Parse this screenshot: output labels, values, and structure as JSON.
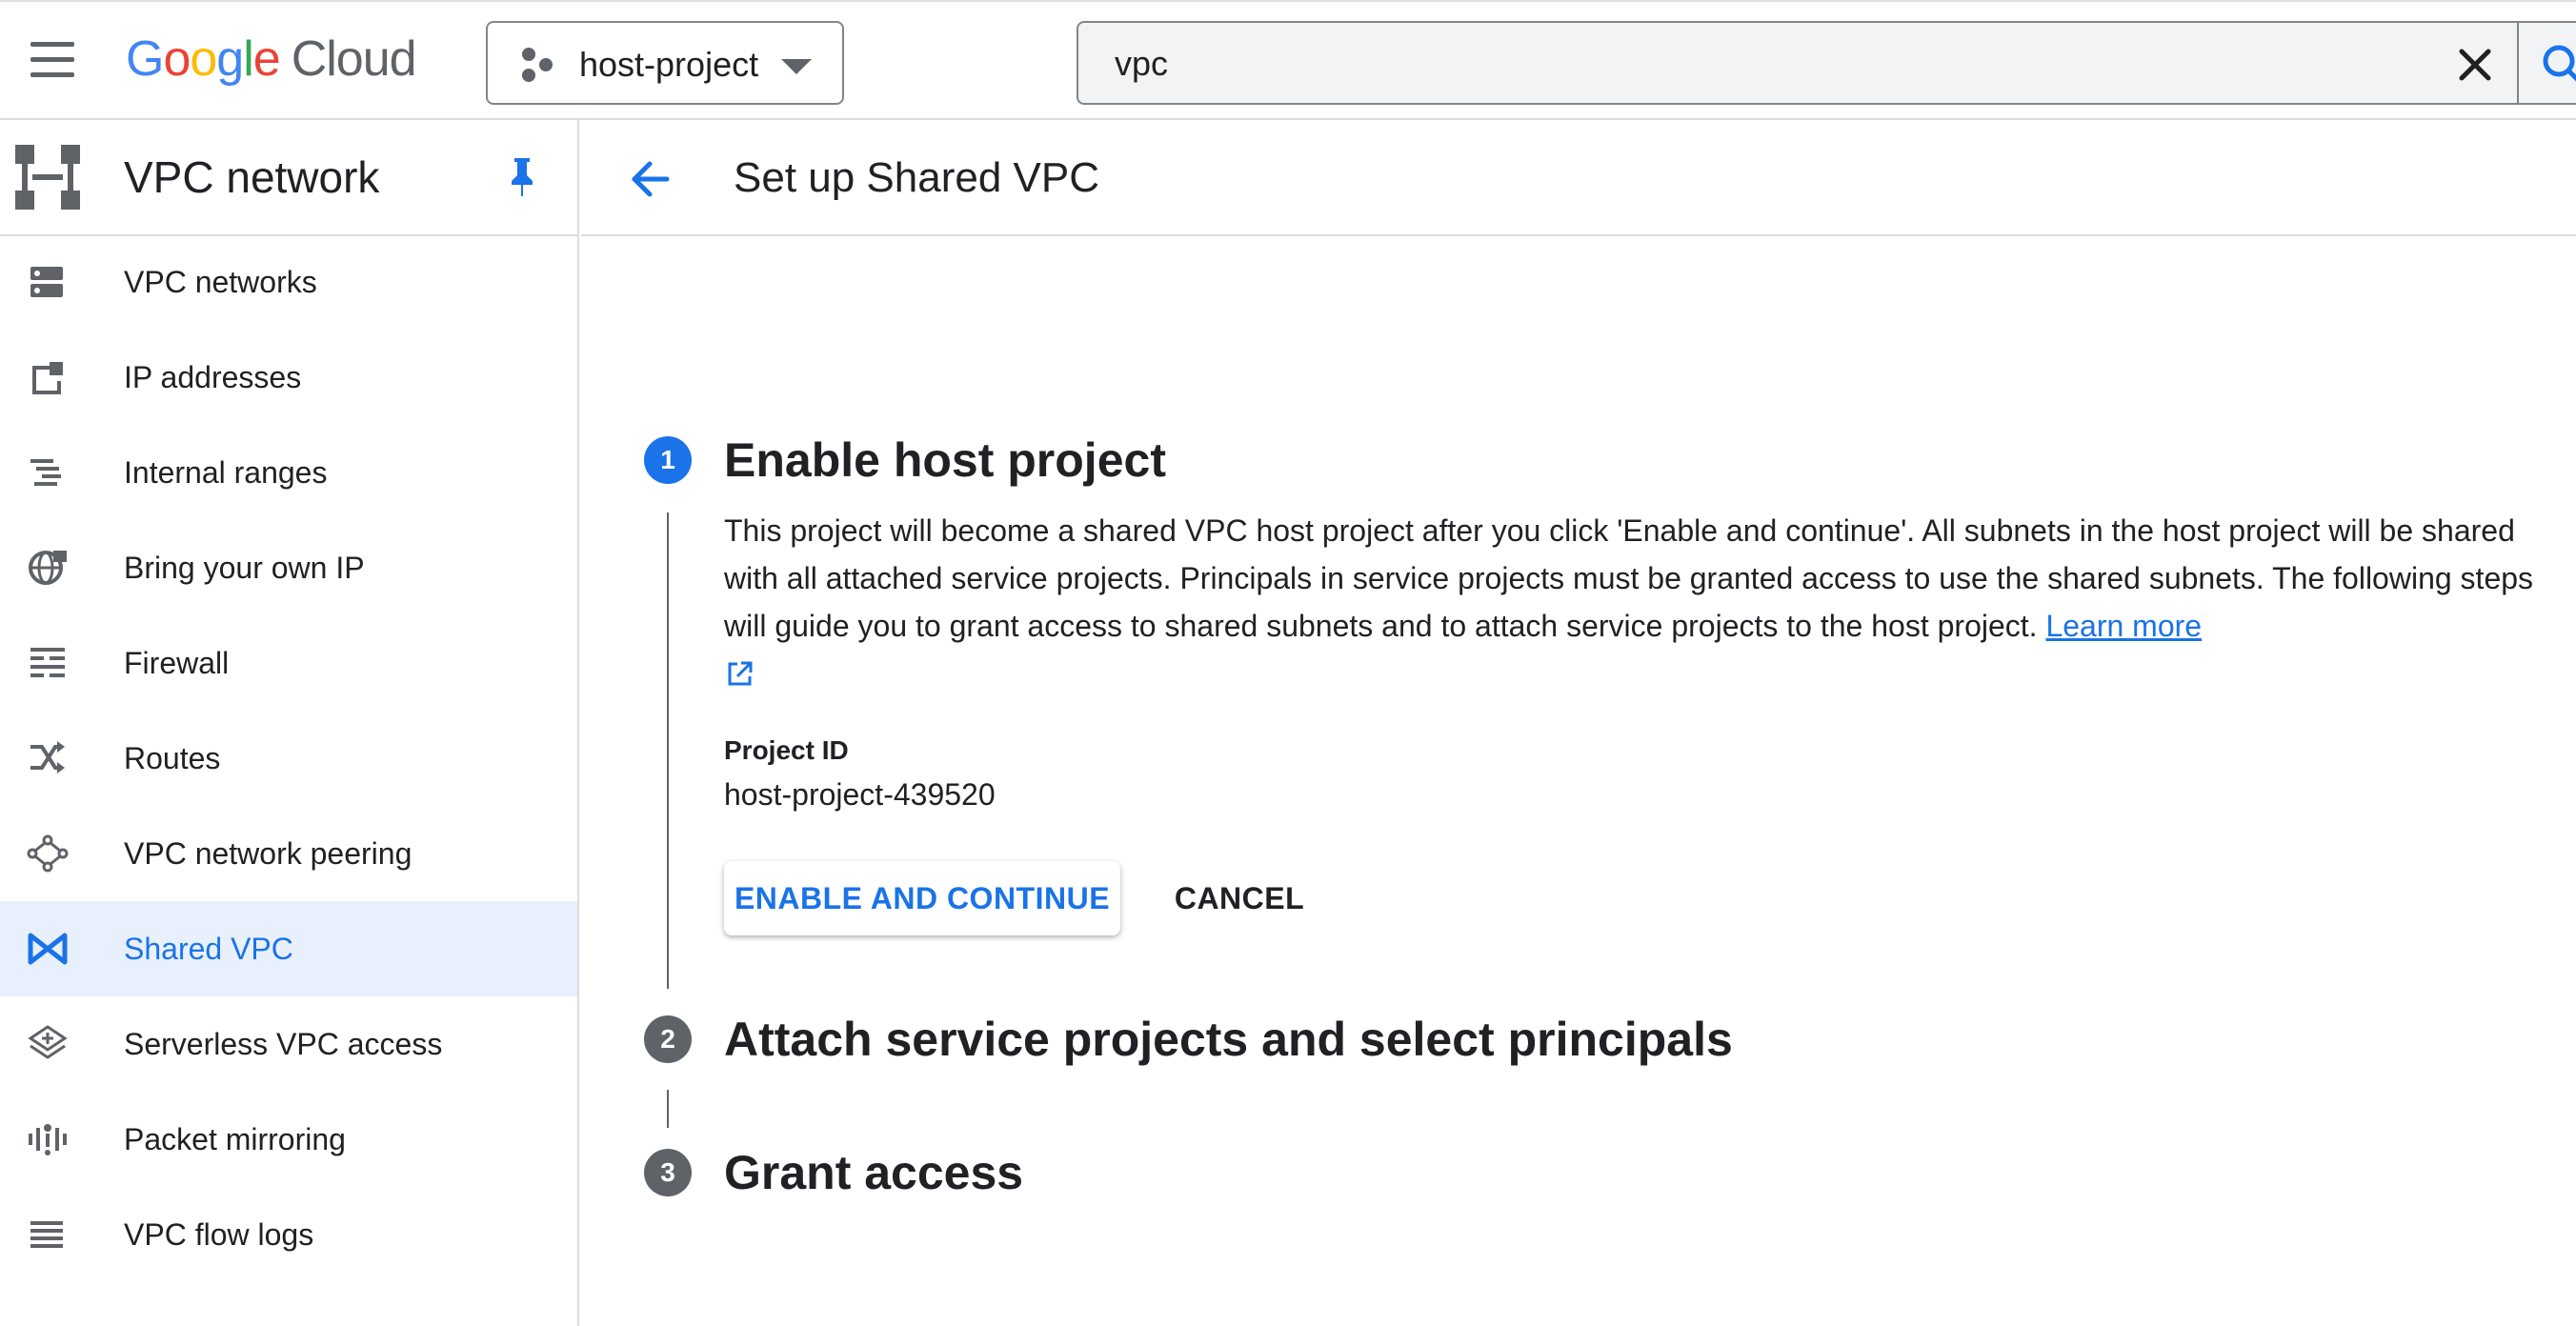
{
  "topbar": {
    "logo_google": [
      "G",
      "o",
      "o",
      "g",
      "l",
      "e"
    ],
    "logo_cloud": "Cloud",
    "project_name": "host-project",
    "search_value": "vpc"
  },
  "sidebar": {
    "title": "VPC network",
    "items": [
      {
        "label": "VPC networks",
        "icon": "vpc-networks-icon"
      },
      {
        "label": "IP addresses",
        "icon": "ip-addresses-icon"
      },
      {
        "label": "Internal ranges",
        "icon": "internal-ranges-icon"
      },
      {
        "label": "Bring your own IP",
        "icon": "globe-icon"
      },
      {
        "label": "Firewall",
        "icon": "firewall-icon"
      },
      {
        "label": "Routes",
        "icon": "routes-icon"
      },
      {
        "label": "VPC network peering",
        "icon": "peering-icon"
      },
      {
        "label": "Shared VPC",
        "icon": "shared-vpc-icon",
        "active": true
      },
      {
        "label": "Serverless VPC access",
        "icon": "serverless-icon"
      },
      {
        "label": "Packet mirroring",
        "icon": "packet-mirroring-icon"
      },
      {
        "label": "VPC flow logs",
        "icon": "flow-logs-icon"
      }
    ]
  },
  "main": {
    "page_title": "Set up Shared VPC",
    "steps": [
      {
        "number": "1",
        "title": "Enable host project"
      },
      {
        "number": "2",
        "title": "Attach service projects and select principals"
      },
      {
        "number": "3",
        "title": "Grant access"
      }
    ],
    "step1": {
      "description": "This project will become a shared VPC host project after you click 'Enable and continue'. All subnets in the host project will be shared with all attached service projects. Principals in service projects must be granted access to use the shared subnets. The following steps will guide you to grant access to shared subnets and to attach service projects to the host project.",
      "learn_more": "Learn more",
      "project_id_label": "Project ID",
      "project_id_value": "host-project-439520",
      "enable_button": "ENABLE AND CONTINUE",
      "cancel_button": "CANCEL"
    }
  },
  "colors": {
    "accent": "#1a73e8",
    "active_nav_bg": "#e8f0fe",
    "icon_gray": "#5f6368",
    "border": "#dadce0"
  }
}
